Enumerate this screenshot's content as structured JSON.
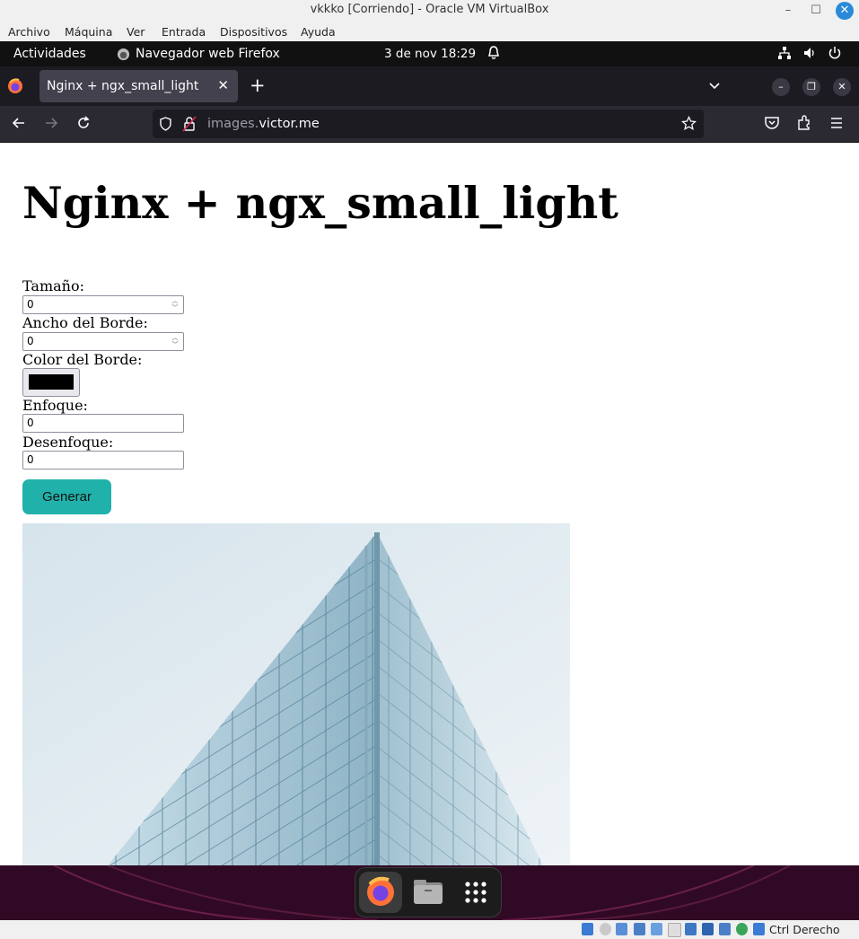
{
  "vbox": {
    "title": "vkkko [Corriendo] - Oracle VM VirtualBox",
    "menu": [
      "Archivo",
      "Máquina",
      "Ver",
      "Entrada",
      "Dispositivos",
      "Ayuda"
    ],
    "host_key": "Ctrl Derecho"
  },
  "gnome": {
    "activities": "Actividades",
    "app_name": "Navegador web Firefox",
    "clock": "3 de nov  18:29"
  },
  "browser": {
    "tab_title": "Nginx + ngx_small_light",
    "url_dim": "images.",
    "url_main": "victor.me"
  },
  "page": {
    "heading": "Nginx + ngx_small_light",
    "size_label": "Tamaño:",
    "size_value": "0",
    "border_width_label": "Ancho del Borde:",
    "border_width_value": "0",
    "border_color_label": "Color del Borde:",
    "border_color_value": "#000000",
    "sharpen_label": "Enfoque:",
    "sharpen_value": "0",
    "blur_label": "Desenfoque:",
    "blur_value": "0",
    "generate_button": "Generar",
    "button_color": "#20b2aa"
  },
  "icons": [
    "firefox-icon",
    "files-icon",
    "app-grid-icon",
    "bell-icon",
    "network-icon",
    "volume-icon",
    "power-icon",
    "shield-icon",
    "lock-icon",
    "star-icon",
    "pocket-icon",
    "extensions-icon",
    "menu-icon"
  ]
}
